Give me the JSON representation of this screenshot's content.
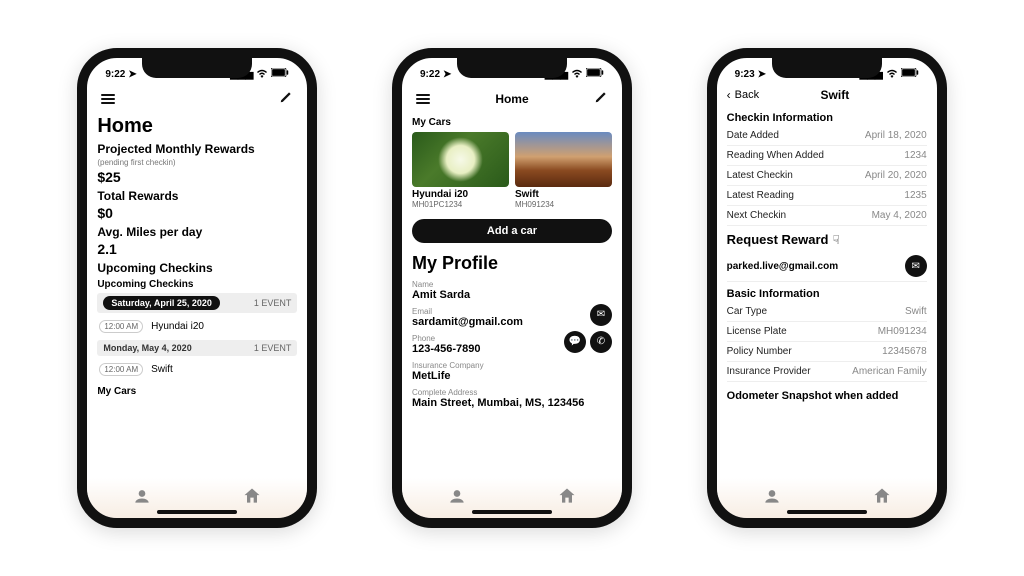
{
  "status": {
    "time1": "9:22",
    "time2": "9:22",
    "time3": "9:23"
  },
  "phone1": {
    "topbar": {
      "title": ""
    },
    "h1": "Home",
    "projected_label": "Projected Monthly Rewards",
    "projected_note": "(pending first checkin)",
    "projected_value": "$25",
    "total_label": "Total Rewards",
    "total_value": "$0",
    "avg_label": "Avg. Miles per day",
    "avg_value": "2.1",
    "upcoming_label": "Upcoming Checkins",
    "upcoming_sub": "Upcoming Checkins",
    "day1": {
      "date": "Saturday, April 25, 2020",
      "count": "1 EVENT",
      "time": "12:00 AM",
      "car": "Hyundai i20"
    },
    "day2": {
      "date": "Monday, May 4, 2020",
      "count": "1 EVENT",
      "time": "12:00 AM",
      "car": "Swift"
    },
    "mycars": "My Cars"
  },
  "phone2": {
    "topbar": {
      "title": "Home"
    },
    "mycars": "My Cars",
    "car1": {
      "name": "Hyundai i20",
      "plate": "MH01PC1234"
    },
    "car2": {
      "name": "Swift",
      "plate": "MH091234"
    },
    "add_car": "Add a car",
    "profile_h": "My Profile",
    "name_label": "Name",
    "name_value": "Amit Sarda",
    "email_label": "Email",
    "email_value": "sardamit@gmail.com",
    "phone_label": "Phone",
    "phone_value": "123-456-7890",
    "ins_label": "Insurance Company",
    "ins_value": "MetLife",
    "addr_label": "Complete Address",
    "addr_value": "Main Street, Mumbai, MS, 123456"
  },
  "phone3": {
    "back": "Back",
    "title": "Swift",
    "checkin_head": "Checkin Information",
    "rows1": [
      {
        "k": "Date Added",
        "v": "April 18, 2020"
      },
      {
        "k": "Reading When Added",
        "v": "1234"
      },
      {
        "k": "Latest Checkin",
        "v": "April 20, 2020"
      },
      {
        "k": "Latest Reading",
        "v": "1235"
      },
      {
        "k": "Next Checkin",
        "v": "May 4, 2020"
      }
    ],
    "reward_head": "Request Reward",
    "reward_email": "parked.live@gmail.com",
    "basic_head": "Basic Information",
    "rows2": [
      {
        "k": "Car Type",
        "v": "Swift"
      },
      {
        "k": "License Plate",
        "v": "MH091234"
      },
      {
        "k": "Policy Number",
        "v": "12345678"
      },
      {
        "k": "Insurance Provider",
        "v": "American Family"
      }
    ],
    "odo_head": "Odometer Snapshot when added"
  }
}
